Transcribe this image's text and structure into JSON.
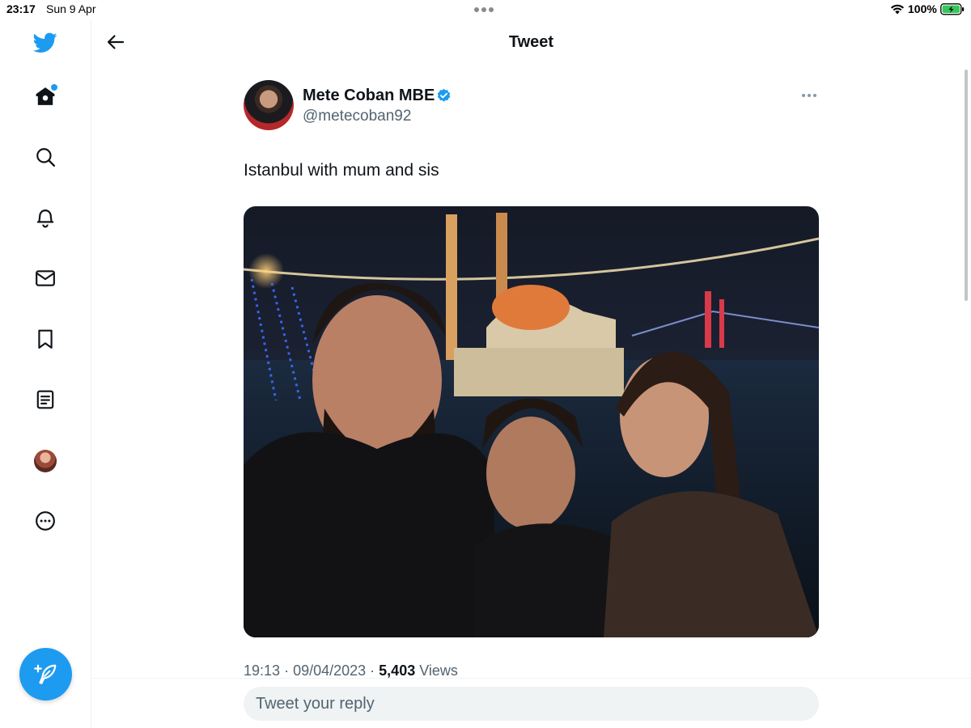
{
  "status_bar": {
    "time": "23:17",
    "date": "Sun 9 Apr",
    "battery": "100%"
  },
  "header": {
    "title": "Tweet"
  },
  "tweet": {
    "author_name": "Mete Coban MBE",
    "handle": "@metecoban92",
    "text": "Istanbul with mum and sis",
    "time": "19:13",
    "date": "09/04/2023",
    "views_count": "5,403",
    "views_label": "Views"
  },
  "reply": {
    "placeholder": "Tweet your reply"
  },
  "icons": {
    "logo": "twitter-bird-icon",
    "nav": [
      "home-icon",
      "search-icon",
      "bell-icon",
      "mail-icon",
      "bookmark-icon",
      "lists-icon",
      "profile-avatar",
      "more-circle-icon"
    ],
    "compose": "compose-feather-icon"
  },
  "colors": {
    "accent": "#1d9bf0",
    "text_primary": "#0f1419",
    "text_secondary": "#536471",
    "reply_bg": "#eff3f4"
  }
}
